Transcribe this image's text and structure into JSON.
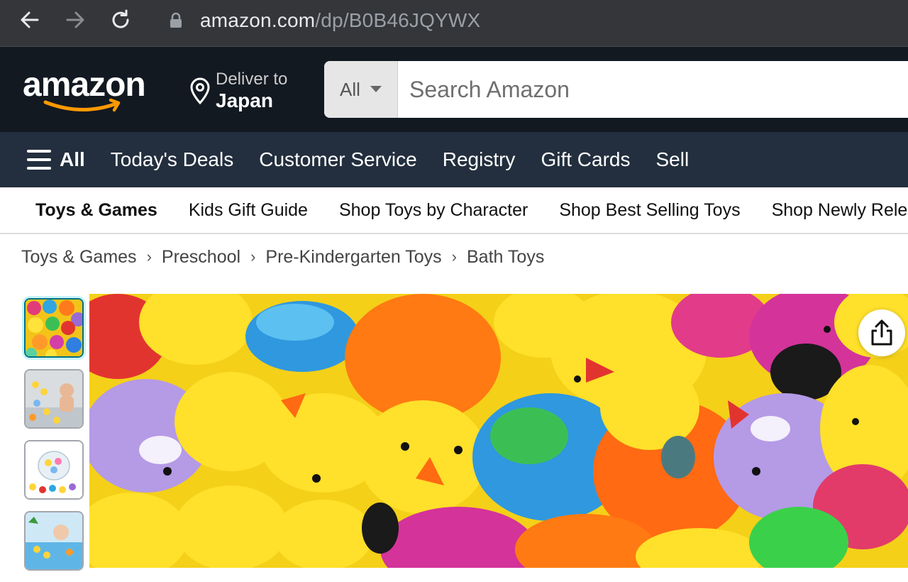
{
  "browser": {
    "url_host": "amazon.com",
    "url_path": "/dp/B0B46JQYWX",
    "back_icon": "arrow-left-icon",
    "forward_icon": "arrow-right-icon",
    "reload_icon": "reload-icon",
    "lock_icon": "lock-icon"
  },
  "header": {
    "logo_text": "amazon",
    "deliver_label": "Deliver to",
    "deliver_location": "Japan",
    "search_category": "All",
    "search_placeholder": "Search Amazon",
    "colors": {
      "background": "#131921",
      "accent": "#febd69",
      "logo_smile": "#ff9900"
    }
  },
  "main_nav": {
    "all_label": "All",
    "items": [
      "Today's Deals",
      "Customer Service",
      "Registry",
      "Gift Cards",
      "Sell"
    ],
    "background": "#232f3e"
  },
  "sub_nav": {
    "items": [
      "Toys & Games",
      "Kids Gift Guide",
      "Shop Toys by Character",
      "Shop Best Selling Toys",
      "Shop Newly Released"
    ]
  },
  "breadcrumb": {
    "items": [
      "Toys & Games",
      "Preschool",
      "Pre-Kindergarten Toys",
      "Bath Toys"
    ],
    "separator": "›"
  },
  "gallery": {
    "thumbnail_count_visible": 4,
    "active_thumbnail": 1,
    "share_icon": "share-icon"
  }
}
